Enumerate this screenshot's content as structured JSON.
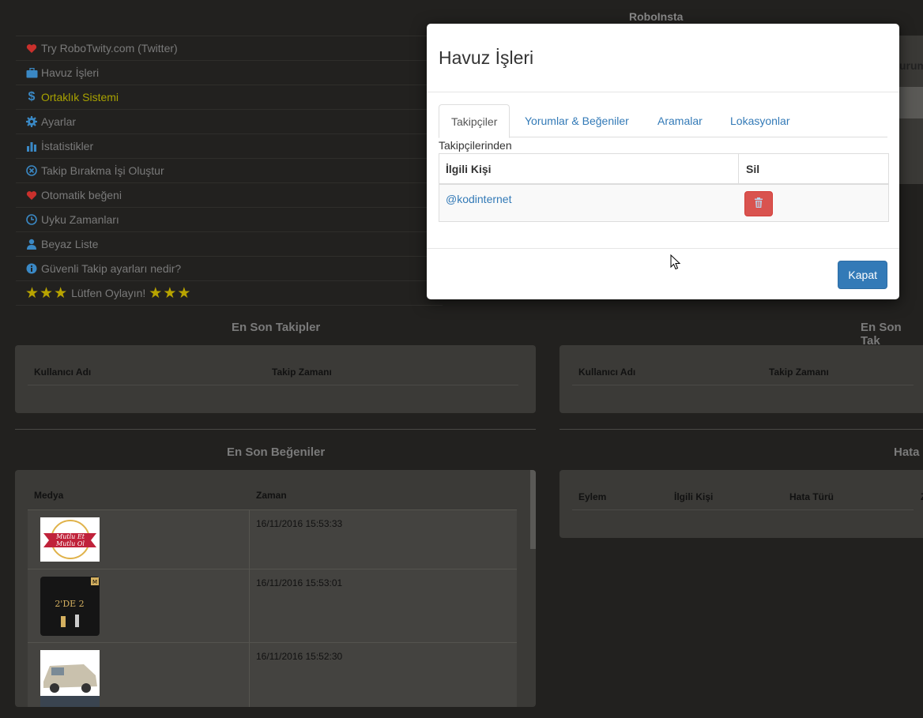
{
  "app": {
    "title": "RoboInsta"
  },
  "menu": {
    "items": [
      {
        "label": "Try RoboTwity.com (Twitter)",
        "icon": "heart-icon"
      },
      {
        "label": "Havuz İşleri",
        "icon": "briefcase-icon"
      },
      {
        "label": "Ortaklık Sistemi",
        "icon": "dollar-icon"
      },
      {
        "label": "Ayarlar",
        "icon": "gear-icon"
      },
      {
        "label": "İstatistikler",
        "icon": "bar-chart-icon"
      },
      {
        "label": "Takip Bırakma İşi Oluştur",
        "icon": "circle-x-icon"
      },
      {
        "label": "Otomatik beğeni",
        "icon": "heart-icon"
      },
      {
        "label": "Uyku Zamanları",
        "icon": "clock-icon"
      },
      {
        "label": "Beyaz Liste",
        "icon": "user-icon"
      },
      {
        "label": "Güvenli Takip ayarları nedir?",
        "icon": "info-icon"
      }
    ],
    "rate": {
      "stars_left": "★★★",
      "label": "Lütfen Oylayın!",
      "stars_right": "★★★"
    }
  },
  "right_peek": {
    "text": "urum"
  },
  "sections": {
    "latest_follows": {
      "title": "En Son Takipler",
      "col_user": "Kullanıcı Adı",
      "col_time": "Takip Zamanı"
    },
    "latest_follows_right": {
      "title": "En Son Tak",
      "col_user": "Kullanıcı Adı",
      "col_time": "Takip Zamanı"
    },
    "latest_likes": {
      "title": "En Son Beğeniler",
      "col_media": "Medya",
      "col_time": "Zaman",
      "rows": [
        {
          "time": "16/11/2016 15:53:33",
          "thumb_text_1": "Mutlu Et",
          "thumb_text_2": "Mutlu Ol"
        },
        {
          "time": "16/11/2016 15:53:01",
          "thumb_text_1": "2'DE 2",
          "thumb_text_2": "M"
        },
        {
          "time": "16/11/2016 15:52:30",
          "thumb_text_1": "",
          "thumb_text_2": ""
        }
      ]
    },
    "errors": {
      "title": "Hata",
      "col_action": "Eylem",
      "col_person": "İlgili Kişi",
      "col_type": "Hata Türü",
      "col_extra": "Z"
    }
  },
  "modal": {
    "title": "Havuz İşleri",
    "tabs": [
      {
        "label": "Takipçiler",
        "active": true
      },
      {
        "label": "Yorumlar & Beğeniler",
        "active": false
      },
      {
        "label": "Aramalar",
        "active": false
      },
      {
        "label": "Lokasyonlar",
        "active": false
      }
    ],
    "subtitle": "Takipçilerinden",
    "table": {
      "col_person": "İlgili Kişi",
      "col_delete": "Sil",
      "rows": [
        {
          "person": "@kodinternet"
        }
      ]
    },
    "close_label": "Kapat"
  },
  "colors": {
    "accent": "#337ab7",
    "danger": "#d9534f",
    "menu_accent": "#a8a200",
    "background": "#22211f"
  }
}
